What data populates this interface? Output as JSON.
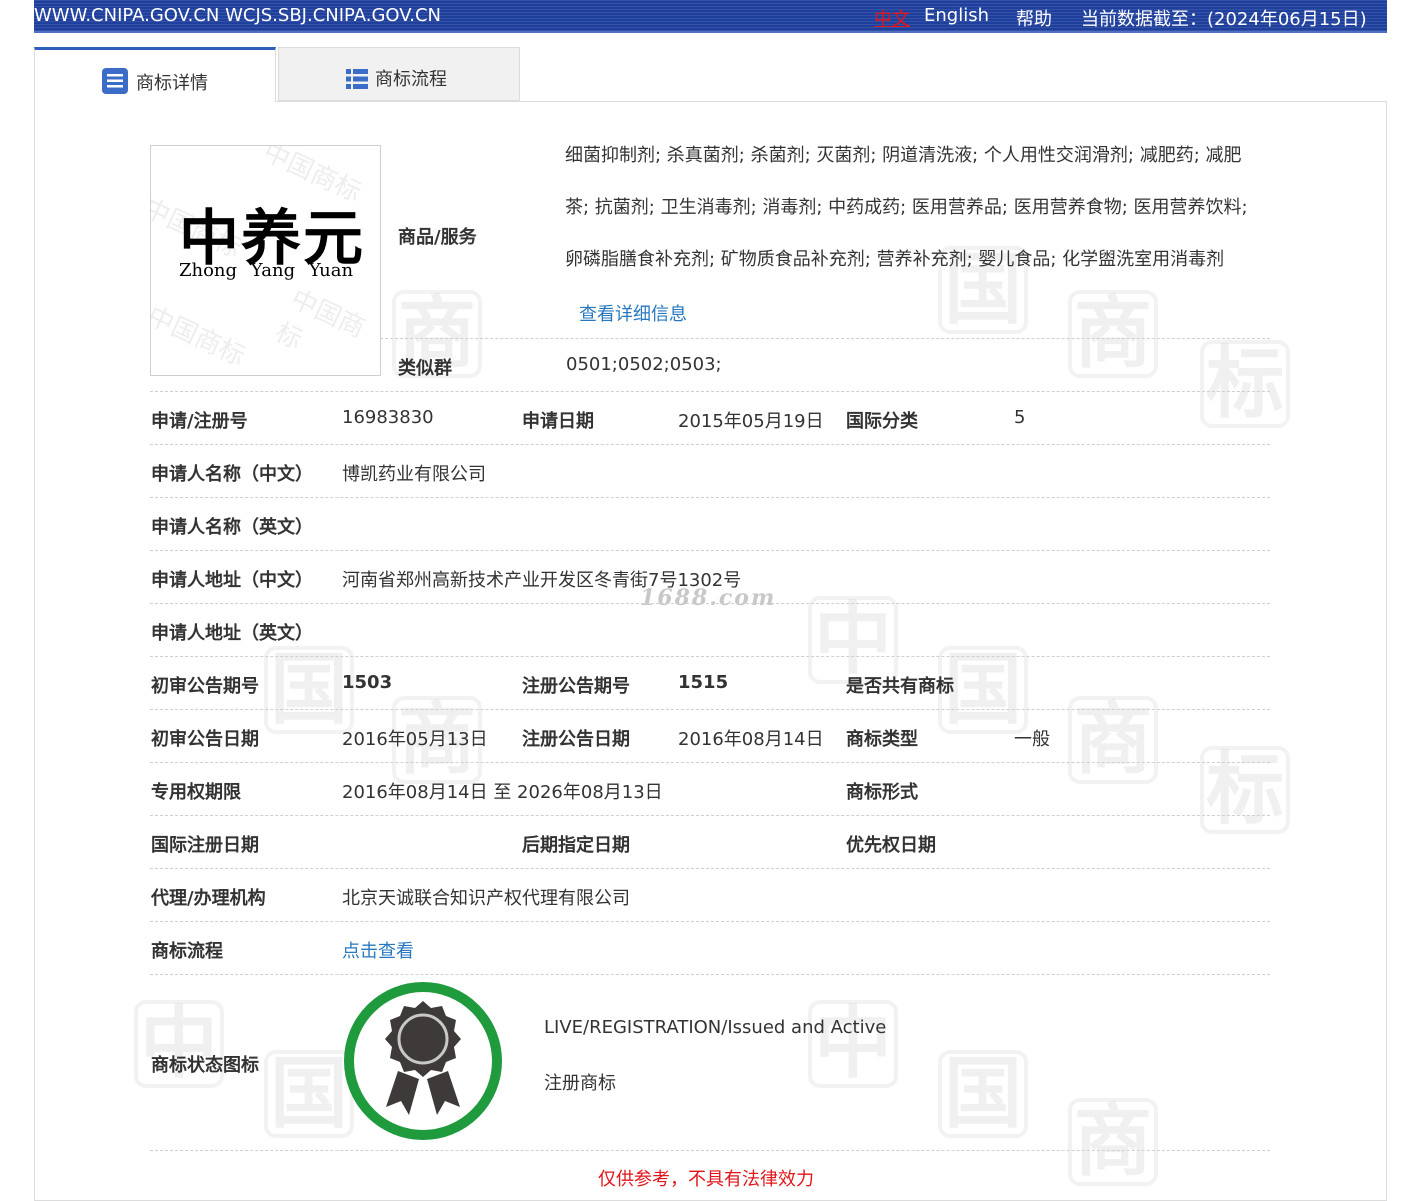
{
  "topbar": {
    "site": "WWW.CNIPA.GOV.CN WCJS.SBJ.CNIPA.GOV.CN",
    "lang_zh": "中文",
    "lang_en": "English",
    "help": "帮助",
    "cutoff": "当前数据截至：(2024年06月15日)"
  },
  "tabs": {
    "details": "商标详情",
    "process": "商标流程"
  },
  "logo": {
    "text_cn": "中养元",
    "text_pinyin": "Zhong  Yang  Yuan",
    "watermark": "中国商标"
  },
  "goods": {
    "label": "商品/服务",
    "lines": [
      "细菌抑制剂; 杀真菌剂; 杀菌剂; 灭菌剂; 阴道清洗液; 个人用性交润滑剂; 减肥药; 减肥",
      "茶; 抗菌剂; 卫生消毒剂; 消毒剂; 中药成药; 医用营养品; 医用营养食物; 医用营养饮料;",
      "卵磷脂膳食补充剂; 矿物质食品补充剂; 营养补充剂; 婴儿食品; 化学盥洗室用消毒剂"
    ],
    "more_link": "查看详细信息"
  },
  "similar_group": {
    "label": "类似群",
    "value": "0501;0502;0503;"
  },
  "rows": {
    "reg_no": {
      "label": "申请/注册号",
      "value": "16983830"
    },
    "app_date": {
      "label": "申请日期",
      "value": "2015年05月19日"
    },
    "intl_class": {
      "label": "国际分类",
      "value": "5"
    },
    "applicant_cn": {
      "label": "申请人名称（中文）",
      "value": "博凯药业有限公司"
    },
    "applicant_en": {
      "label": "申请人名称（英文）",
      "value": ""
    },
    "address_cn": {
      "label": "申请人地址（中文）",
      "value": "河南省郑州高新技术产业开发区冬青街7号1302号"
    },
    "address_en": {
      "label": "申请人地址（英文）",
      "value": ""
    },
    "prelim_issue": {
      "label": "初审公告期号",
      "value": "1503"
    },
    "reg_issue": {
      "label": "注册公告期号",
      "value": "1515"
    },
    "shared": {
      "label": "是否共有商标",
      "value": ""
    },
    "prelim_date": {
      "label": "初审公告日期",
      "value": "2016年05月13日"
    },
    "reg_date": {
      "label": "注册公告日期",
      "value": "2016年08月14日"
    },
    "mark_type": {
      "label": "商标类型",
      "value": "一般"
    },
    "term": {
      "label": "专用权期限",
      "value": "2016年08月14日 至 2026年08月13日"
    },
    "mark_form": {
      "label": "商标形式",
      "value": ""
    },
    "intl_reg_date": {
      "label": "国际注册日期",
      "value": ""
    },
    "later_date": {
      "label": "后期指定日期",
      "value": ""
    },
    "priority_date": {
      "label": "优先权日期",
      "value": ""
    },
    "agent": {
      "label": "代理/办理机构",
      "value": "北京天诚联合知识产权代理有限公司"
    },
    "process": {
      "label": "商标流程",
      "link": "点击查看"
    }
  },
  "status": {
    "label": "商标状态图标",
    "en": "LIVE/REGISTRATION/Issued and Active",
    "cn": "注册商标",
    "ring_color": "#1f9a3c",
    "badge_color": "#3d3a39"
  },
  "source_watermark": "1688.com",
  "footer_note": "仅供参考，不具有法律效力",
  "watermark_chars": [
    "中",
    "国",
    "商",
    "标"
  ]
}
